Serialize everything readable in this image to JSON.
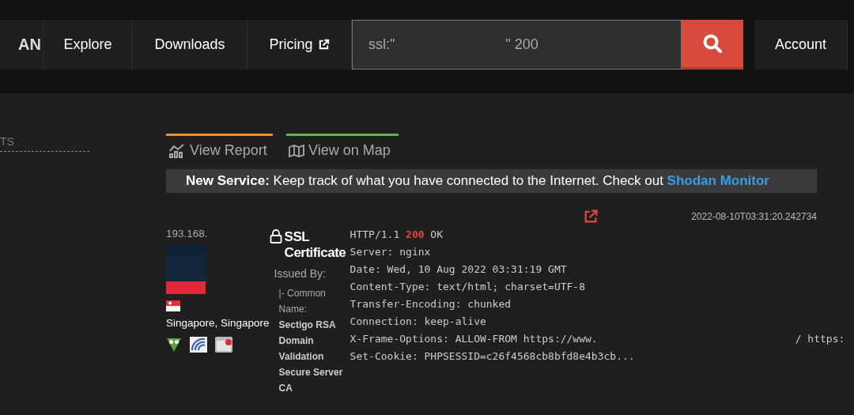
{
  "nav": {
    "logo": "AN",
    "items": [
      {
        "label": "Explore",
        "external": false
      },
      {
        "label": "Downloads",
        "external": false
      },
      {
        "label": "Pricing",
        "external": true
      }
    ],
    "search": {
      "value_parts": [
        "ssl:\"",
        "\" 200"
      ]
    },
    "account": "Account"
  },
  "sidebar": {
    "heading": "TS"
  },
  "tabs": [
    {
      "label": "View Report",
      "kind": "report",
      "color": "#e8912d"
    },
    {
      "label": "View on Map",
      "kind": "map",
      "color": "#6ab04c"
    }
  ],
  "banner": {
    "text": "**New Service:** Keep track of what you have connected to the Internet. Check out",
    "link": "Shodan Monitor"
  },
  "result": {
    "timestamp": "2022-08-10T03:31:20.242734",
    "ip": "193.168.",
    "location": "Singapore, Singapore",
    "ssl": {
      "title": "SSL Certificate",
      "issued_by": "Issued By:",
      "field": "|- Common Name:",
      "value": "Sectigo RSA Domain Validation Secure Server CA"
    },
    "response": [
      {
        "text": "HTTP/1.1 ",
        "status": "200",
        "rest": " OK"
      },
      {
        "text": "Server: nginx"
      },
      {
        "text": "Date: Wed, 10 Aug 2022 03:31:19 GMT"
      },
      {
        "text": "Content-Type: text/html; charset=UTF-8"
      },
      {
        "text": "Transfer-Encoding: chunked"
      },
      {
        "text": "Connection: keep-alive"
      },
      {
        "text": "X-Frame-Options: ALLOW-FROM https://www.",
        "tail": "/ https:"
      },
      {
        "text": "Set-Cookie: PHPSESSID=c26f4568cb8bfd8e4b3cb..."
      }
    ]
  }
}
